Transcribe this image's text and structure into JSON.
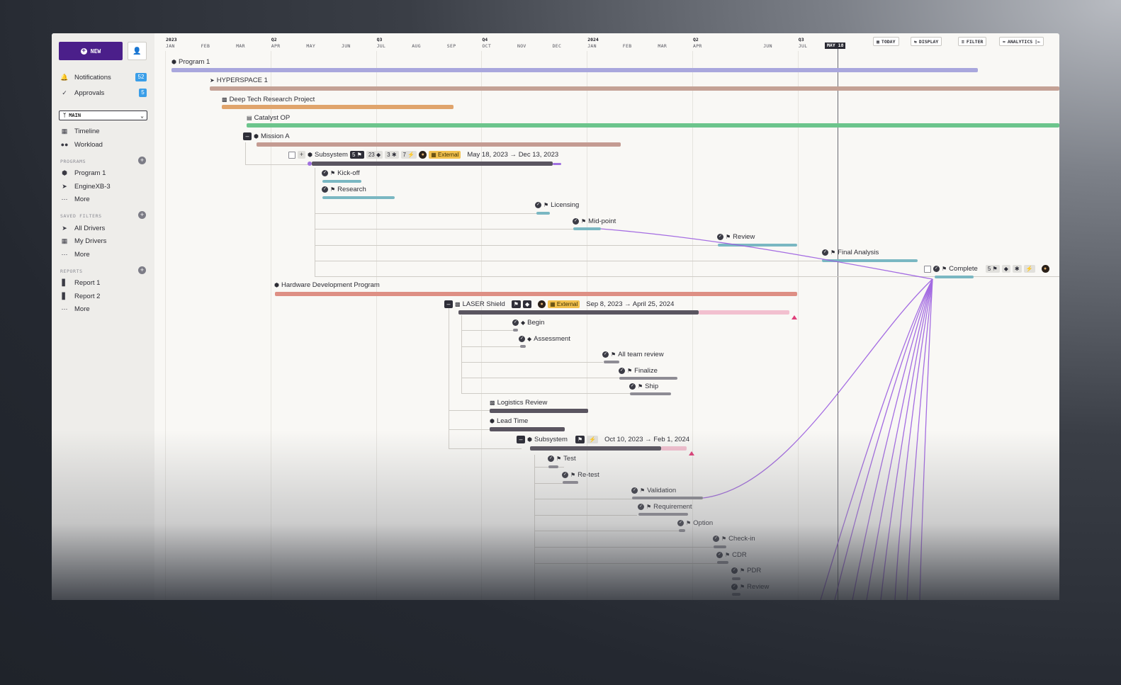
{
  "sidebar": {
    "new_label": "NEW",
    "notifications": {
      "label": "Notifications",
      "count": "52"
    },
    "approvals": {
      "label": "Approvals",
      "count": "5"
    },
    "branch": "MAIN",
    "views": [
      {
        "label": "Timeline"
      },
      {
        "label": "Workload"
      }
    ],
    "programs": {
      "heading": "PROGRAMS",
      "items": [
        {
          "label": "Program 1"
        },
        {
          "label": "EngineXB-3"
        },
        {
          "label": "More"
        }
      ]
    },
    "saved_filters": {
      "heading": "SAVED FILTERS",
      "items": [
        {
          "label": "All Drivers"
        },
        {
          "label": "My Drivers"
        },
        {
          "label": "More"
        }
      ]
    },
    "reports": {
      "heading": "REPORTS",
      "items": [
        {
          "label": "Report 1"
        },
        {
          "label": "Report 2"
        },
        {
          "label": "More"
        }
      ]
    }
  },
  "toolbar": {
    "today": "TODAY",
    "display": "DISPLAY",
    "filter": "FILTER",
    "analytics": "ANALYTICS"
  },
  "header": {
    "months": [
      "JAN",
      "FEB",
      "MAR",
      "APR",
      "MAY",
      "JUN",
      "JUL",
      "AUG",
      "SEP",
      "OCT",
      "NOV",
      "DEC",
      "JAN",
      "FEB",
      "MAR",
      "APR",
      "MAY 18",
      "JUN",
      "JUL",
      "AUG"
    ],
    "periods": [
      "2023",
      "Q2",
      "Q3",
      "Q4",
      "2024",
      "Q2",
      "Q3"
    ],
    "today_marker": "MAY 18"
  },
  "rows": {
    "program1": "Program 1",
    "hyperspace": "HYPERSPACE 1",
    "deeptech": "Deep Tech Research Project",
    "catalyst": "Catalyst OP",
    "missionA": "Mission A",
    "subsystem1": {
      "label": "Subsystem",
      "milestones": "5",
      "diamonds": "23",
      "stars": "3",
      "bolts": "7",
      "tag": "External",
      "dates": "May 18, 2023 → Dec 13, 2023"
    },
    "kickoff": "Kick-off",
    "research": "Research",
    "licensing": "Licensing",
    "midpoint": "Mid-point",
    "review": "Review",
    "final": "Final Analysis",
    "complete": {
      "label": "Complete",
      "count": "5"
    },
    "hardware": "Hardware Development Program",
    "laser": {
      "label": "LASER Shield",
      "tag": "External",
      "dates": "Sep 8, 2023 → April 25, 2024"
    },
    "begin": "Begin",
    "assessment": "Assessment",
    "allteam": "All team review",
    "finalize": "Finalize",
    "ship": "Ship",
    "logistics": "Logistics Review",
    "leadtime": "Lead Time",
    "subsystem2": {
      "label": "Subsystem",
      "dates": "Oct 10, 2023 → Feb 1, 2024"
    },
    "test": "Test",
    "retest": "Re-test",
    "validation": "Validation",
    "requirement": "Requirement",
    "option": "Option",
    "checkin": "Check-in",
    "cdr": "CDR",
    "pdr": "PDR",
    "review2": "Review"
  },
  "colors": {
    "accent": "#4b1f8a",
    "program": "#a9a7dd",
    "hyperspace": "#c4a195",
    "deeptech": "#e0a46c",
    "catalyst": "#6cc58c",
    "mission": "#c49b92",
    "hardware": "#de8f84",
    "milestone": "#7ab7c2",
    "dependency": "#9b5de0"
  }
}
